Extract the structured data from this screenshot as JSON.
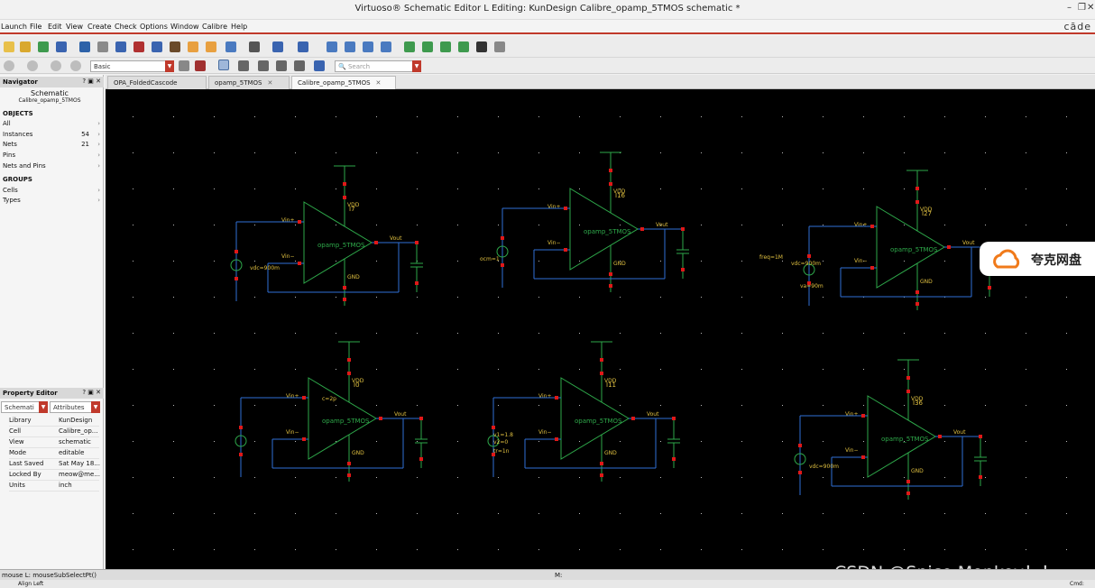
{
  "window": {
    "title": "Virtuoso® Schematic Editor L Editing: KunDesign Calibre_opamp_5TMOS schematic *",
    "controls": [
      "–",
      "❐",
      "✕"
    ]
  },
  "menubar": {
    "items": [
      "Launch",
      "File",
      "Edit",
      "View",
      "Create",
      "Check",
      "Options",
      "Window",
      "Calibre",
      "Help"
    ],
    "brand": "cāde"
  },
  "toolbar2": {
    "workspace_value": "Basic",
    "search_placeholder": "Search"
  },
  "tabs": [
    {
      "label": "OPA_FoldedCascode",
      "active": false
    },
    {
      "label": "opamp_5TMOS",
      "active": false
    },
    {
      "label": "Calibre_opamp_5TMOS",
      "active": true
    }
  ],
  "navigator": {
    "title": "Navigator",
    "view_title": "Schematic",
    "view_subtitle": "Calibre_opamp_5TMOS",
    "objects_header": "OBJECTS",
    "objects": [
      {
        "label": "All",
        "count": ""
      },
      {
        "label": "Instances",
        "count": "54"
      },
      {
        "label": "Nets",
        "count": "21"
      },
      {
        "label": "Pins",
        "count": ""
      },
      {
        "label": "Nets and Pins",
        "count": ""
      }
    ],
    "groups_header": "GROUPS",
    "groups": [
      {
        "label": "Cells"
      },
      {
        "label": "Types"
      }
    ]
  },
  "property_editor": {
    "title": "Property Editor",
    "type_value": "Schemati",
    "mode_value": "Attributes",
    "rows": [
      {
        "key": "Library",
        "value": "KunDesign"
      },
      {
        "key": "Cell",
        "value": "Calibre_op..."
      },
      {
        "key": "View",
        "value": "schematic"
      },
      {
        "key": "Mode",
        "value": "editable"
      },
      {
        "key": "Last Saved",
        "value": "Sat May 18..."
      },
      {
        "key": "Locked By",
        "value": "meow@me..."
      },
      {
        "key": "Units",
        "value": "inch"
      }
    ]
  },
  "schematic": {
    "opamps": [
      {
        "label": "opamp_5TMOS",
        "inst": "I7"
      },
      {
        "label": "opamp_5TMOS",
        "inst": "I16"
      },
      {
        "label": "opamp_5TMOS",
        "inst": "I27"
      },
      {
        "label": "opamp_5TMOS",
        "inst": "I0"
      },
      {
        "label": "opamp_5TMOS",
        "inst": "I11"
      },
      {
        "label": "opamp_5TMOS",
        "inst": "I36"
      }
    ],
    "pin_labels": {
      "vinp": "Vin+",
      "vinm": "Vin−",
      "vout": "Vout",
      "vdd": "VDD",
      "gnd": "GND"
    },
    "annotations": [
      "vdc=900m",
      "c=2p",
      "ocm=1",
      "vdc=900m",
      "freq=1M",
      "va=90m",
      "v1=1.8",
      "v2=0",
      "tr=1n",
      "vdc=900m"
    ]
  },
  "status": {
    "left": "mouse L: mouseSubSelectPt()",
    "middle": "M:",
    "bottom_left": "Align Left",
    "bottom_right": "Cmd:"
  },
  "overlays": {
    "cloud_text": "夸克网盘",
    "watermark": "CSDN @Spice Monkey！！"
  },
  "colors": {
    "canvas_bg": "#000000",
    "wire": "#2f6fd6",
    "symbol": "#2ea84a",
    "pin": "#e01818",
    "label": "#e0c040",
    "accent": "#c0392b"
  }
}
